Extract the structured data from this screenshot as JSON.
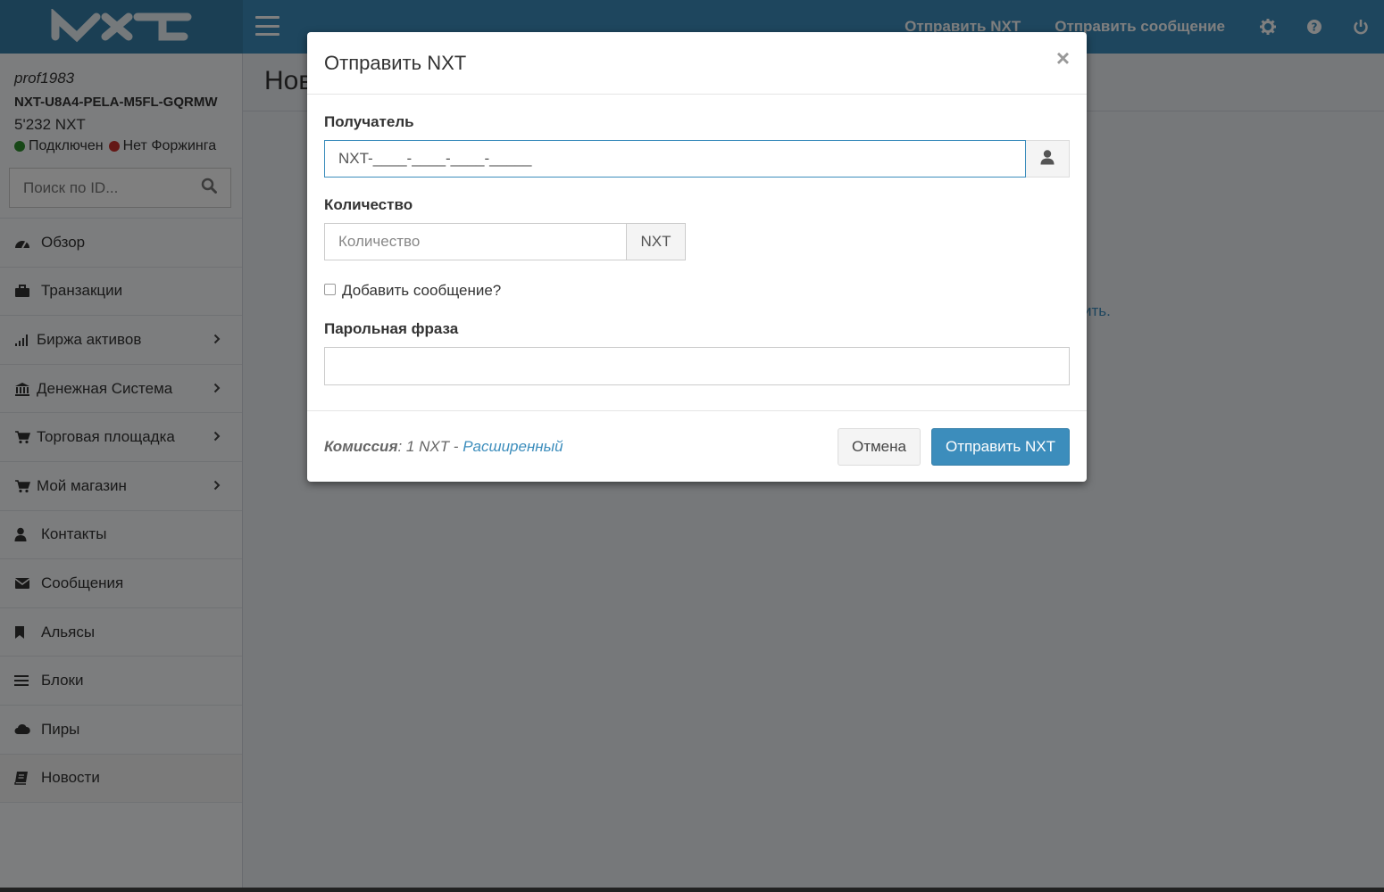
{
  "header": {
    "nav": {
      "send_nxt": "Отправить NXT",
      "send_message": "Отправить сообщение"
    },
    "icons": [
      "gear-icon",
      "help-icon",
      "power-icon"
    ],
    "colors": {
      "bar": "#3c8dbc",
      "logo_bg": "#367fa9"
    }
  },
  "user": {
    "name": "prof1983",
    "account": "NXT-U8A4-PELA-M5FL-GQRMW",
    "balance": "5'232 NXT",
    "connected": "Подключен",
    "forging": "Нет Форжинга",
    "colors": {
      "connected": "#2f8f2f",
      "forging": "#c9302c"
    }
  },
  "search": {
    "placeholder": "Поиск по ID..."
  },
  "sidebar": {
    "items": [
      {
        "label": "Обзор",
        "icon": "dashboard-icon"
      },
      {
        "label": "Транзакции",
        "icon": "briefcase-icon"
      },
      {
        "label": "Биржа активов",
        "icon": "signal-icon"
      },
      {
        "label": "Денежная Система",
        "icon": "bank-icon"
      },
      {
        "label": "Торговая площадка",
        "icon": "cart-icon"
      },
      {
        "label": "Мой магазин",
        "icon": "cart-icon"
      },
      {
        "label": "Контакты",
        "icon": "user-icon"
      },
      {
        "label": "Сообщения",
        "icon": "envelope-icon"
      },
      {
        "label": "Альясы",
        "icon": "bookmark-icon"
      },
      {
        "label": "Блоки",
        "icon": "bars-icon"
      },
      {
        "label": "Пиры",
        "icon": "cloud-icon"
      },
      {
        "label": "Новости",
        "icon": "book-icon"
      }
    ]
  },
  "content": {
    "title": "Нов",
    "link": "ить."
  },
  "modal": {
    "title": "Отправить NXT",
    "close": "×",
    "recipient_label": "Получатель",
    "recipient_value": "NXT-____-____-____-_____",
    "amount_label": "Количество",
    "amount_placeholder": "Количество",
    "amount_unit": "NXT",
    "add_message": "Добавить сообщение?",
    "passphrase_label": "Парольная фраза",
    "fee_label": "Комиссия",
    "fee_value": ": 1 NXT - ",
    "advanced": "Расширенный",
    "cancel": "Отмена",
    "submit": "Отправить NXT"
  }
}
